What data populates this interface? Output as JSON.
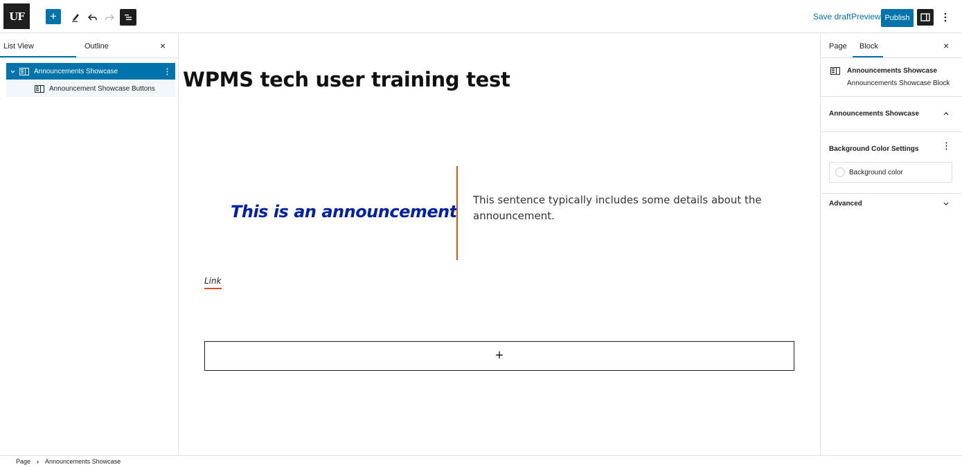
{
  "topbar": {
    "logo_text": "UF",
    "add_block_label": "+",
    "save_draft": "Save draft",
    "preview": "Preview",
    "publish": "Publish"
  },
  "left_panel": {
    "tabs": [
      {
        "label": "List View"
      },
      {
        "label": "Outline"
      }
    ],
    "close": "×",
    "tree": [
      {
        "label": "Announcements Showcase"
      },
      {
        "label": "Announcement Showcase Buttons"
      }
    ]
  },
  "canvas": {
    "page_title": "WPMS tech user training test",
    "announcement_heading": "This is an announcement",
    "announcement_body": "This sentence typically includes some details about the announcement.",
    "link_text": "Link",
    "appender_label": "+"
  },
  "right_panel": {
    "tabs": [
      {
        "label": "Page"
      },
      {
        "label": "Block"
      }
    ],
    "close": "×",
    "block_name": "Announcements Showcase",
    "block_description": "Announcements Showcase Block",
    "sections": {
      "showcase": "Announcements Showcase",
      "bg_settings": "Background Color Settings",
      "bg_color_label": "Background color",
      "advanced": "Advanced"
    }
  },
  "footer": {
    "crumbs": [
      "Page",
      "Announcements Showcase"
    ]
  },
  "colors": {
    "accent": "#0073aa",
    "uf_blue": "#0021a5",
    "uf_orange": "#e44e1a"
  }
}
